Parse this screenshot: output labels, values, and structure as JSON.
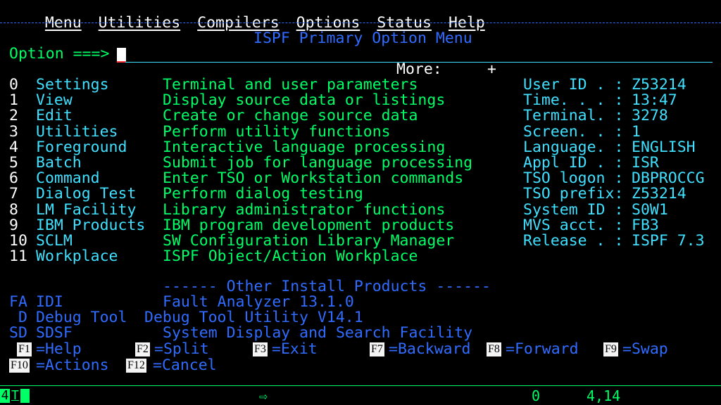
{
  "menubar": [
    "Menu",
    "Utilities",
    "Compilers",
    "Options",
    "Status",
    "Help"
  ],
  "title": "ISPF Primary Option Menu",
  "option_label": "Option ===>",
  "more": {
    "label": "More:",
    "symbol": "+"
  },
  "options": [
    {
      "num": "0",
      "name": "Settings",
      "desc": "Terminal and user parameters"
    },
    {
      "num": "1",
      "name": "View",
      "desc": "Display source data or listings"
    },
    {
      "num": "2",
      "name": "Edit",
      "desc": "Create or change source data"
    },
    {
      "num": "3",
      "name": "Utilities",
      "desc": "Perform utility functions"
    },
    {
      "num": "4",
      "name": "Foreground",
      "desc": "Interactive language processing"
    },
    {
      "num": "5",
      "name": "Batch",
      "desc": "Submit job for language processing"
    },
    {
      "num": "6",
      "name": "Command",
      "desc": "Enter TSO or Workstation commands"
    },
    {
      "num": "7",
      "name": "Dialog Test",
      "desc": "Perform dialog testing"
    },
    {
      "num": "8",
      "name": "LM Facility",
      "desc": "Library administrator functions"
    },
    {
      "num": "9",
      "name": "IBM Products",
      "desc": "IBM program development products"
    },
    {
      "num": "10",
      "name": "SCLM",
      "desc": "SW Configuration Library Manager"
    },
    {
      "num": "11",
      "name": "Workplace",
      "desc": "ISPF Object/Action Workplace"
    }
  ],
  "info": [
    {
      "label": "User ID . :",
      "value": "Z53214"
    },
    {
      "label": "Time. . . :",
      "value": "13:47"
    },
    {
      "label": "Terminal. :",
      "value": "3278"
    },
    {
      "label": "Screen. . :",
      "value": "1"
    },
    {
      "label": "Language. :",
      "value": "ENGLISH"
    },
    {
      "label": "Appl ID . :",
      "value": "ISR"
    },
    {
      "label": "TSO logon :",
      "value": "DBPROCCG"
    },
    {
      "label": "TSO prefix:",
      "value": "Z53214"
    },
    {
      "label": "System ID :",
      "value": "S0W1"
    },
    {
      "label": "MVS acct. :",
      "value": "FB3"
    },
    {
      "label": "Release . :",
      "value": "ISPF 7.3"
    }
  ],
  "other_header": "------ Other Install Products ------",
  "other_products": [
    {
      "code": "FA",
      "name": "IDI",
      "desc": "Fault Analyzer 13.1.0"
    },
    {
      "code": "D",
      "name": "Debug Tool",
      "desc": "Debug Tool Utility V14.1"
    },
    {
      "code": "SD",
      "name": "SDSF",
      "desc": "System Display and Search Facility"
    }
  ],
  "fkeys_row1": [
    {
      "key": "F1",
      "label": "=Help"
    },
    {
      "key": "F2",
      "label": "=Split"
    },
    {
      "key": "F3",
      "label": "=Exit"
    },
    {
      "key": "F7",
      "label": "=Backward"
    },
    {
      "key": "F8",
      "label": "=Forward"
    },
    {
      "key": "F9",
      "label": "=Swap"
    }
  ],
  "fkeys_row2": [
    {
      "key": "F10",
      "label": "=Actions"
    },
    {
      "key": "F12",
      "label": "=Cancel"
    }
  ],
  "oia": {
    "indicator_num": "4",
    "indicator_letter": "T",
    "arrow": "⇨",
    "counter": "0",
    "cursor_pos": "4,14"
  },
  "colors": {
    "green": "#00ff66",
    "turquoise": "#40e0ff",
    "blue": "#2f6cff",
    "white": "#ffffff"
  }
}
